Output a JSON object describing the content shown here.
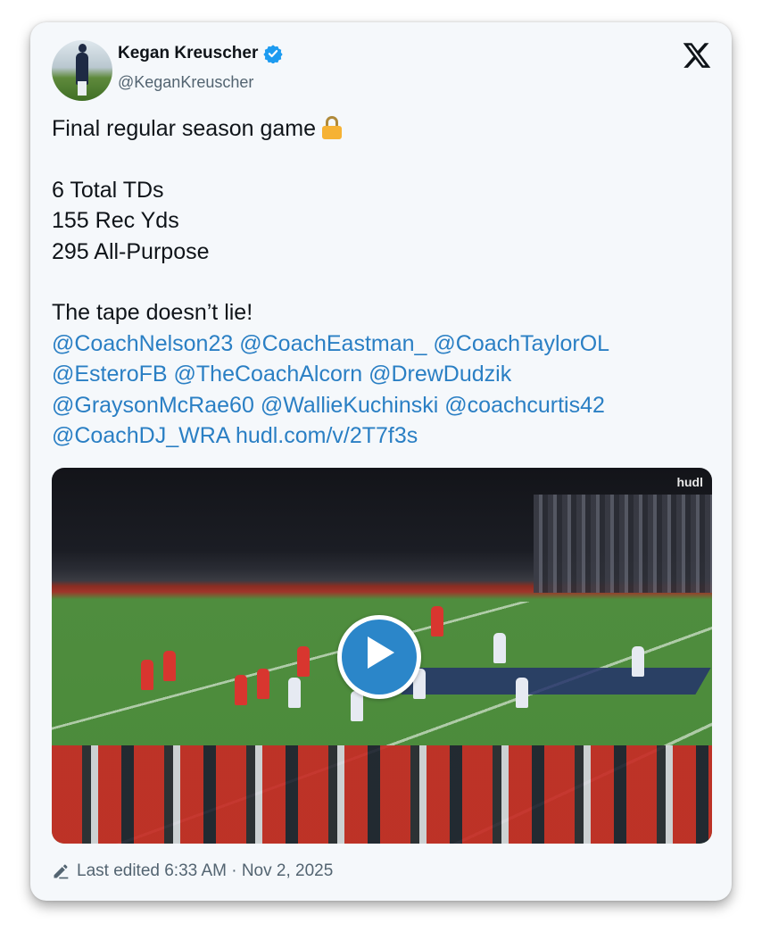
{
  "author": {
    "name": "Kegan Kreuscher",
    "handle": "@KeganKreuscher",
    "verified": true
  },
  "post": {
    "line1": "Final regular season game",
    "line1_emoji": "lock-icon",
    "stats": [
      "6 Total TDs",
      "155 Rec Yds",
      "295 All-Purpose"
    ],
    "tagline": "The tape doesn’t lie!",
    "mentions": [
      [
        "@CoachNelson23",
        "@CoachEastman_",
        "@CoachTaylorOL"
      ],
      [
        "@EsteroFB",
        "@TheCoachAlcorn",
        "@DrewDudzik"
      ],
      [
        "@GraysonMcRae60",
        "@WallieKuchinski",
        "@coachcurtis42"
      ],
      [
        "@CoachDJ_WRA",
        "hudl.com/v/2T7f3s"
      ]
    ]
  },
  "media": {
    "watermark": "hudl"
  },
  "footer": {
    "edited_text": "Last edited 6:33 AM · Nov 2, 2025"
  },
  "colors": {
    "link": "#2a7fc4",
    "verified": "#1d9bf0",
    "play_button": "#2b86c9",
    "card_bg": "#f5f8fb"
  }
}
